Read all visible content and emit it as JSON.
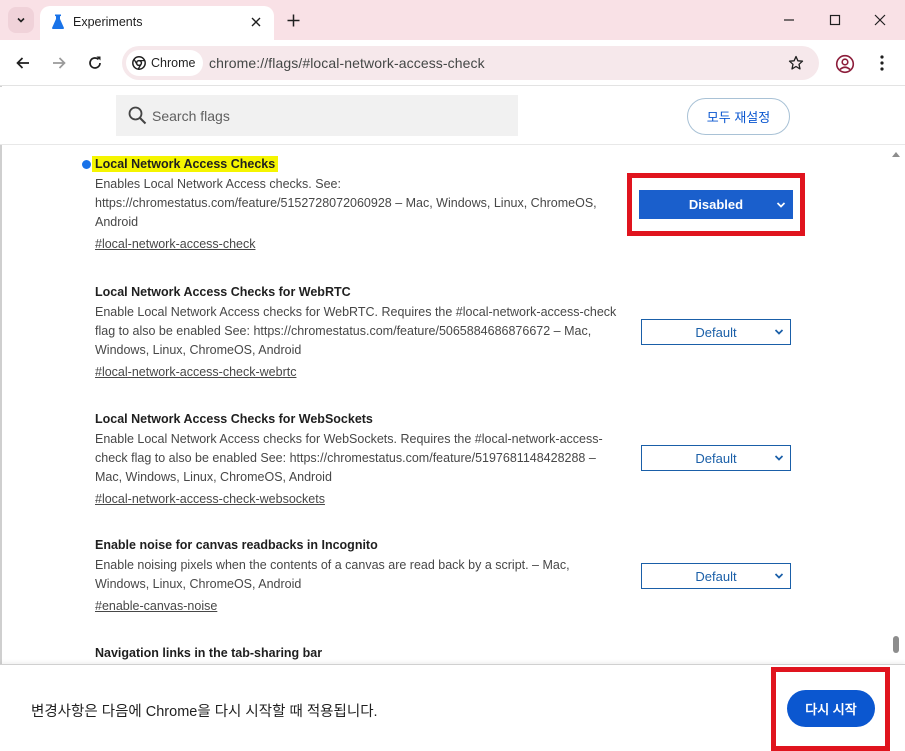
{
  "tab": {
    "title": "Experiments"
  },
  "toolbar": {
    "chip_label": "Chrome",
    "url": "chrome://flags/#local-network-access-check"
  },
  "search": {
    "placeholder": "Search flags",
    "reset_label": "모두 재설정"
  },
  "flags": [
    {
      "title": "Local Network Access Checks",
      "desc_lines": [
        "Enables Local Network Access checks. See:",
        "https://chromestatus.com/feature/5152728072060928 – Mac, Windows, Linux, ChromeOS,",
        "Android"
      ],
      "link": "#local-network-access-check",
      "value": "Disabled",
      "modified": true
    },
    {
      "title": "Local Network Access Checks for WebRTC",
      "desc_lines": [
        "Enable Local Network Access checks for WebRTC. Requires the #local-network-access-check",
        "flag to also be enabled See: https://chromestatus.com/feature/5065884686876672 – Mac,",
        "Windows, Linux, ChromeOS, Android"
      ],
      "link": "#local-network-access-check-webrtc",
      "value": "Default"
    },
    {
      "title": "Local Network Access Checks for WebSockets",
      "desc_lines": [
        "Enable Local Network Access checks for WebSockets. Requires the #local-network-access-",
        "check flag to also be enabled See: https://chromestatus.com/feature/5197681148428288 –",
        "Mac, Windows, Linux, ChromeOS, Android"
      ],
      "link": "#local-network-access-check-websockets",
      "value": "Default"
    },
    {
      "title": "Enable noise for canvas readbacks in Incognito",
      "desc_lines": [
        "Enable noising pixels when the contents of a canvas are read back by a script. – Mac,",
        "Windows, Linux, ChromeOS, Android"
      ],
      "link": "#enable-canvas-noise",
      "value": "Default"
    },
    {
      "title": "Navigation links in the tab-sharing bar"
    }
  ],
  "bottom": {
    "message": "변경사항은 다음에 Chrome을 다시 시작할 때 적용됩니다.",
    "restart_label": "다시 시작"
  },
  "colors": {
    "accent": "#0b57d0",
    "highlight": "#f5f500",
    "annotation_red": "#e0141e",
    "tabstrip": "#f9e1e6"
  }
}
